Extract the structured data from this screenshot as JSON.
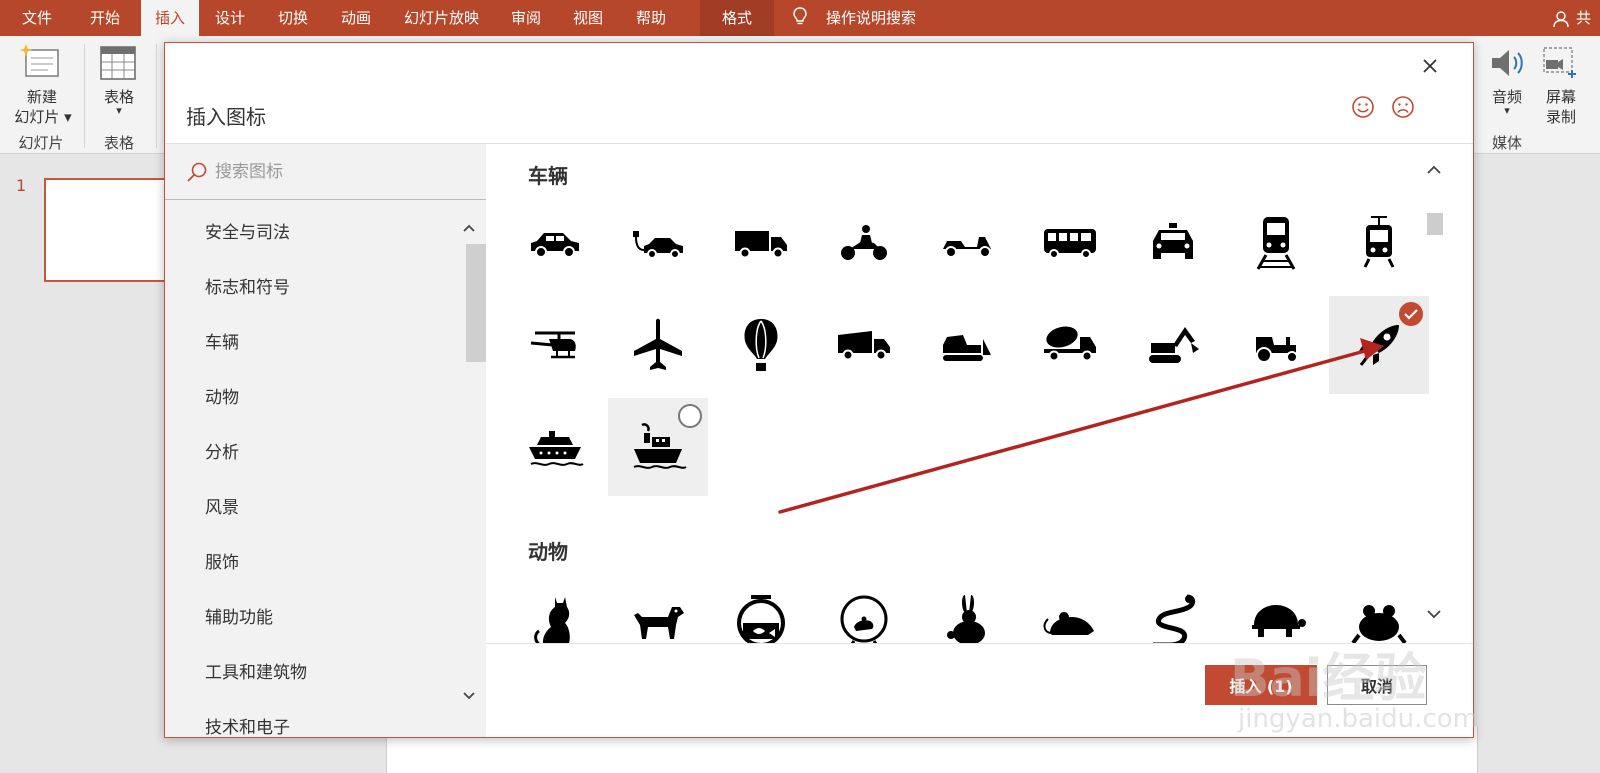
{
  "ribbon_tabs": [
    "文件",
    "开始",
    "插入",
    "设计",
    "切换",
    "动画",
    "幻灯片放映",
    "审阅",
    "视图",
    "帮助",
    "格式"
  ],
  "tell_me": "操作说明搜索",
  "share": "共享",
  "ribbon": {
    "new_slide": [
      "新建",
      "幻灯片"
    ],
    "table": "表格",
    "group_slides": "幻灯片",
    "group_tables": "表格",
    "audio": "音频",
    "screen_record": [
      "屏幕",
      "录制"
    ],
    "group_media": "媒体"
  },
  "slide_number": "1",
  "dialog": {
    "title": "插入图标",
    "search_placeholder": "搜索图标",
    "categories": [
      "安全与司法",
      "标志和符号",
      "车辆",
      "动物",
      "分析",
      "风景",
      "服饰",
      "辅助功能",
      "工具和建筑物",
      "技术和电子"
    ],
    "sections": [
      {
        "title": "车辆",
        "icons": [
          "car-icon",
          "electric-car-icon",
          "truck-icon",
          "motorcycle-icon",
          "scooter-icon",
          "bus-icon",
          "taxi-icon",
          "train-icon",
          "tram-icon",
          "helicopter-icon",
          "airplane-icon",
          "hot-air-balloon-icon",
          "dump-truck-icon",
          "bulldozer-icon",
          "cement-mixer-icon",
          "excavator-icon",
          "tractor-icon",
          "rocket-icon",
          "cruise-ship-icon",
          "steamboat-icon"
        ],
        "selected": "rocket-icon",
        "hovered": "steamboat-icon"
      },
      {
        "title": "动物",
        "icons": [
          "cat-icon",
          "dog-icon",
          "fishbowl-icon",
          "hamster-wheel-icon",
          "rabbit-icon",
          "mouse-icon",
          "snake-icon",
          "turtle-icon",
          "frog-icon"
        ]
      }
    ],
    "insert_button": "插入 (1)",
    "cancel_button": "取消"
  },
  "watermark": {
    "text": "Bai经验",
    "url": "jingyan.baidu.com"
  },
  "colors": {
    "accent": "#b7472a",
    "selected_check": "#c24a32",
    "annotation_arrow": "#b3241f"
  }
}
